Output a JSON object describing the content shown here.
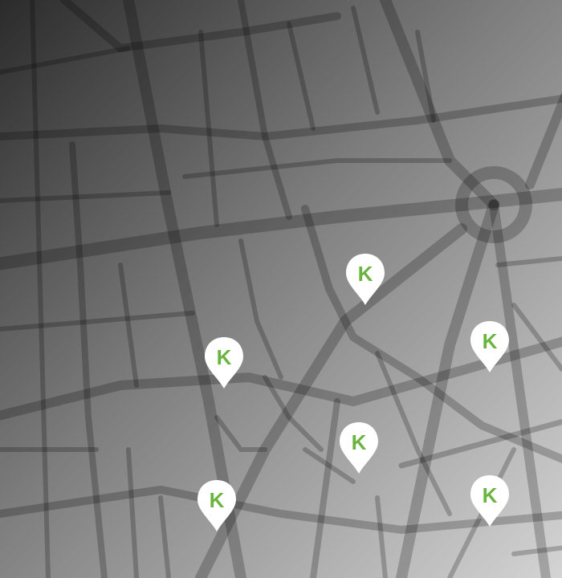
{
  "map": {
    "gradient_start": "#2c2c2c",
    "gradient_mid": "#8a8a8a",
    "gradient_end": "#cfcfcf",
    "street_color": "#5a5a5a"
  },
  "marker": {
    "glyph": "K",
    "icon": "map-pin-icon",
    "pin_color": "#ffffff",
    "glyph_color": "#6ab540"
  },
  "markers": [
    {
      "id": "marker-1",
      "glyph": "K"
    },
    {
      "id": "marker-2",
      "glyph": "K"
    },
    {
      "id": "marker-3",
      "glyph": "K"
    },
    {
      "id": "marker-4",
      "glyph": "K"
    },
    {
      "id": "marker-5",
      "glyph": "K"
    },
    {
      "id": "marker-6",
      "glyph": "K"
    }
  ]
}
